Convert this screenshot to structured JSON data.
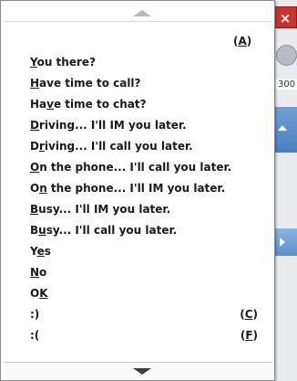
{
  "background": {
    "close_glyph": "×",
    "partial_number": "300"
  },
  "menu": {
    "top_shortcut": "(A)",
    "items": [
      {
        "pre": "",
        "u": "Y",
        "post": "ou there?",
        "shortcut": ""
      },
      {
        "pre": "",
        "u": "H",
        "post": "ave time to call?",
        "shortcut": ""
      },
      {
        "pre": "Ha",
        "u": "v",
        "post": "e time to chat?",
        "shortcut": ""
      },
      {
        "pre": "",
        "u": "D",
        "post": "riving... I'll IM you later.",
        "shortcut": ""
      },
      {
        "pre": "D",
        "u": "r",
        "post": "iving... I'll call you later.",
        "shortcut": ""
      },
      {
        "pre": "",
        "u": "O",
        "post": "n the phone... I'll call you later.",
        "shortcut": ""
      },
      {
        "pre": "O",
        "u": "n",
        "post": " the phone... I'll IM you later.",
        "shortcut": ""
      },
      {
        "pre": "",
        "u": "B",
        "post": "usy... I'll IM you later.",
        "shortcut": ""
      },
      {
        "pre": "B",
        "u": "u",
        "post": "sy... I'll call you later.",
        "shortcut": ""
      },
      {
        "pre": "Y",
        "u": "e",
        "post": "s",
        "shortcut": ""
      },
      {
        "pre": "",
        "u": "N",
        "post": "o",
        "shortcut": ""
      },
      {
        "pre": "O",
        "u": "K",
        "post": "",
        "shortcut": ""
      },
      {
        "pre": ":)",
        "u": "",
        "post": "",
        "shortcut": "(C)",
        "shortcut_u": "C"
      },
      {
        "pre": ":(",
        "u": "",
        "post": "",
        "shortcut": "(F)",
        "shortcut_u": "F"
      }
    ]
  }
}
